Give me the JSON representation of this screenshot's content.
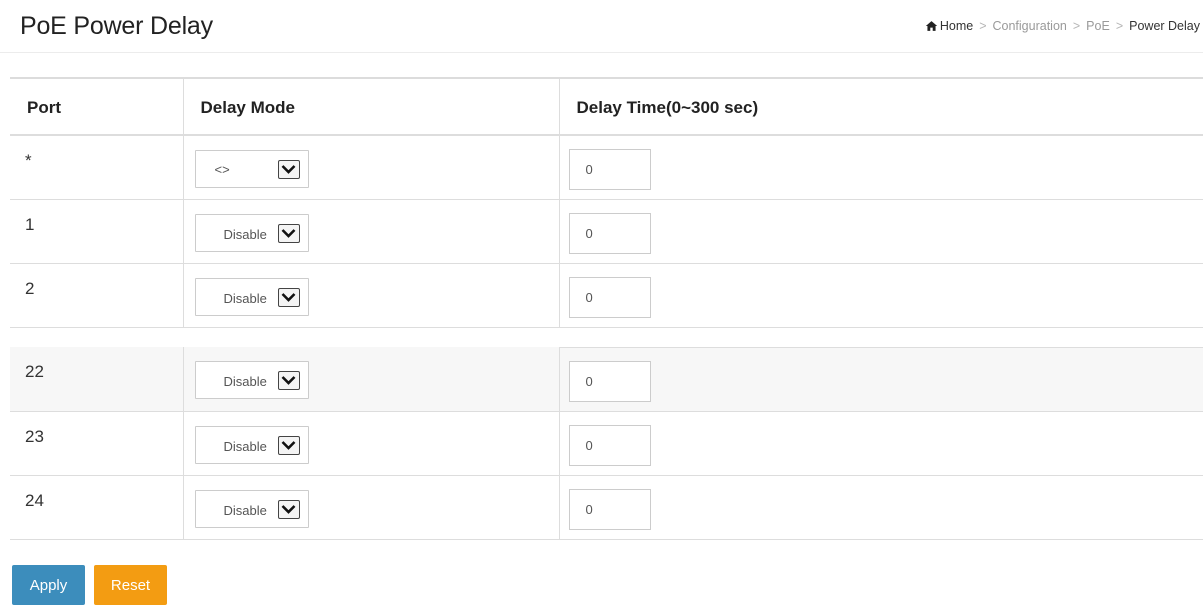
{
  "header": {
    "title": "PoE Power Delay",
    "breadcrumb": {
      "home": "Home",
      "items": [
        "Configuration",
        "PoE"
      ],
      "current": "Power Delay",
      "separator": ">"
    }
  },
  "table": {
    "columns": [
      "Port",
      "Delay Mode",
      "Delay Time(0~300 sec)"
    ],
    "rows_top": [
      {
        "port": "*",
        "mode": "<>",
        "time": "0"
      },
      {
        "port": "1",
        "mode": "Disable",
        "time": "0"
      },
      {
        "port": "2",
        "mode": "Disable",
        "time": "0"
      }
    ],
    "rows_bottom": [
      {
        "port": "22",
        "mode": "Disable",
        "time": "0"
      },
      {
        "port": "23",
        "mode": "Disable",
        "time": "0"
      },
      {
        "port": "24",
        "mode": "Disable",
        "time": "0"
      }
    ]
  },
  "buttons": {
    "apply": "Apply",
    "reset": "Reset"
  },
  "colors": {
    "apply": "#3c8dbc",
    "reset": "#f39c12"
  },
  "icons": {
    "home": "home-icon",
    "dropdown": "chevron-down-icon"
  }
}
